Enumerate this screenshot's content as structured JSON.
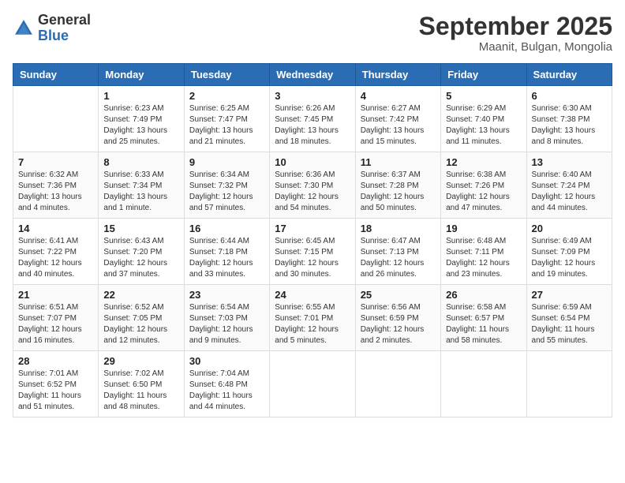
{
  "header": {
    "logo_general": "General",
    "logo_blue": "Blue",
    "month_title": "September 2025",
    "subtitle": "Maanit, Bulgan, Mongolia"
  },
  "days_of_week": [
    "Sunday",
    "Monday",
    "Tuesday",
    "Wednesday",
    "Thursday",
    "Friday",
    "Saturday"
  ],
  "weeks": [
    [
      {
        "day": "",
        "info": ""
      },
      {
        "day": "1",
        "info": "Sunrise: 6:23 AM\nSunset: 7:49 PM\nDaylight: 13 hours and 25 minutes."
      },
      {
        "day": "2",
        "info": "Sunrise: 6:25 AM\nSunset: 7:47 PM\nDaylight: 13 hours and 21 minutes."
      },
      {
        "day": "3",
        "info": "Sunrise: 6:26 AM\nSunset: 7:45 PM\nDaylight: 13 hours and 18 minutes."
      },
      {
        "day": "4",
        "info": "Sunrise: 6:27 AM\nSunset: 7:42 PM\nDaylight: 13 hours and 15 minutes."
      },
      {
        "day": "5",
        "info": "Sunrise: 6:29 AM\nSunset: 7:40 PM\nDaylight: 13 hours and 11 minutes."
      },
      {
        "day": "6",
        "info": "Sunrise: 6:30 AM\nSunset: 7:38 PM\nDaylight: 13 hours and 8 minutes."
      }
    ],
    [
      {
        "day": "7",
        "info": "Sunrise: 6:32 AM\nSunset: 7:36 PM\nDaylight: 13 hours and 4 minutes."
      },
      {
        "day": "8",
        "info": "Sunrise: 6:33 AM\nSunset: 7:34 PM\nDaylight: 13 hours and 1 minute."
      },
      {
        "day": "9",
        "info": "Sunrise: 6:34 AM\nSunset: 7:32 PM\nDaylight: 12 hours and 57 minutes."
      },
      {
        "day": "10",
        "info": "Sunrise: 6:36 AM\nSunset: 7:30 PM\nDaylight: 12 hours and 54 minutes."
      },
      {
        "day": "11",
        "info": "Sunrise: 6:37 AM\nSunset: 7:28 PM\nDaylight: 12 hours and 50 minutes."
      },
      {
        "day": "12",
        "info": "Sunrise: 6:38 AM\nSunset: 7:26 PM\nDaylight: 12 hours and 47 minutes."
      },
      {
        "day": "13",
        "info": "Sunrise: 6:40 AM\nSunset: 7:24 PM\nDaylight: 12 hours and 44 minutes."
      }
    ],
    [
      {
        "day": "14",
        "info": "Sunrise: 6:41 AM\nSunset: 7:22 PM\nDaylight: 12 hours and 40 minutes."
      },
      {
        "day": "15",
        "info": "Sunrise: 6:43 AM\nSunset: 7:20 PM\nDaylight: 12 hours and 37 minutes."
      },
      {
        "day": "16",
        "info": "Sunrise: 6:44 AM\nSunset: 7:18 PM\nDaylight: 12 hours and 33 minutes."
      },
      {
        "day": "17",
        "info": "Sunrise: 6:45 AM\nSunset: 7:15 PM\nDaylight: 12 hours and 30 minutes."
      },
      {
        "day": "18",
        "info": "Sunrise: 6:47 AM\nSunset: 7:13 PM\nDaylight: 12 hours and 26 minutes."
      },
      {
        "day": "19",
        "info": "Sunrise: 6:48 AM\nSunset: 7:11 PM\nDaylight: 12 hours and 23 minutes."
      },
      {
        "day": "20",
        "info": "Sunrise: 6:49 AM\nSunset: 7:09 PM\nDaylight: 12 hours and 19 minutes."
      }
    ],
    [
      {
        "day": "21",
        "info": "Sunrise: 6:51 AM\nSunset: 7:07 PM\nDaylight: 12 hours and 16 minutes."
      },
      {
        "day": "22",
        "info": "Sunrise: 6:52 AM\nSunset: 7:05 PM\nDaylight: 12 hours and 12 minutes."
      },
      {
        "day": "23",
        "info": "Sunrise: 6:54 AM\nSunset: 7:03 PM\nDaylight: 12 hours and 9 minutes."
      },
      {
        "day": "24",
        "info": "Sunrise: 6:55 AM\nSunset: 7:01 PM\nDaylight: 12 hours and 5 minutes."
      },
      {
        "day": "25",
        "info": "Sunrise: 6:56 AM\nSunset: 6:59 PM\nDaylight: 12 hours and 2 minutes."
      },
      {
        "day": "26",
        "info": "Sunrise: 6:58 AM\nSunset: 6:57 PM\nDaylight: 11 hours and 58 minutes."
      },
      {
        "day": "27",
        "info": "Sunrise: 6:59 AM\nSunset: 6:54 PM\nDaylight: 11 hours and 55 minutes."
      }
    ],
    [
      {
        "day": "28",
        "info": "Sunrise: 7:01 AM\nSunset: 6:52 PM\nDaylight: 11 hours and 51 minutes."
      },
      {
        "day": "29",
        "info": "Sunrise: 7:02 AM\nSunset: 6:50 PM\nDaylight: 11 hours and 48 minutes."
      },
      {
        "day": "30",
        "info": "Sunrise: 7:04 AM\nSunset: 6:48 PM\nDaylight: 11 hours and 44 minutes."
      },
      {
        "day": "",
        "info": ""
      },
      {
        "day": "",
        "info": ""
      },
      {
        "day": "",
        "info": ""
      },
      {
        "day": "",
        "info": ""
      }
    ]
  ]
}
